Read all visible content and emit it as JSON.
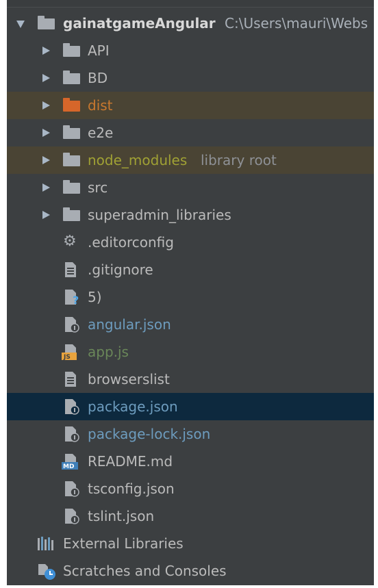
{
  "project": {
    "name": "gainatgameAngular",
    "path": "C:\\Users\\mauri\\Webs"
  },
  "folders": [
    {
      "label": "API"
    },
    {
      "label": "BD"
    },
    {
      "label": "dist"
    },
    {
      "label": "e2e"
    },
    {
      "label": "node_modules",
      "suffix": "library root"
    },
    {
      "label": "src"
    },
    {
      "label": "superadmin_libraries"
    }
  ],
  "files": [
    {
      "label": ".editorconfig",
      "icon": "gear-icon"
    },
    {
      "label": ".gitignore",
      "icon": "text-file-icon"
    },
    {
      "label": "5)",
      "icon": "unknown-file-icon"
    },
    {
      "label": "angular.json",
      "icon": "json-file-icon"
    },
    {
      "label": "app.js",
      "icon": "js-file-icon"
    },
    {
      "label": "browserslist",
      "icon": "text-file-icon"
    },
    {
      "label": "package.json",
      "icon": "json-file-icon"
    },
    {
      "label": "package-lock.json",
      "icon": "json-file-icon"
    },
    {
      "label": "README.md",
      "icon": "markdown-file-icon"
    },
    {
      "label": "tsconfig.json",
      "icon": "json-file-icon"
    },
    {
      "label": "tslint.json",
      "icon": "json-file-icon"
    }
  ],
  "bottom": [
    {
      "label": "External Libraries",
      "icon": "library-icon"
    },
    {
      "label": "Scratches and Consoles",
      "icon": "scratches-icon"
    }
  ],
  "badges": {
    "js": "JS",
    "md": "MD",
    "unknown": "?"
  },
  "colors": {
    "panel_bg": "#3c3f41",
    "selected_row": "#0d293e",
    "excluded_row": "#4a4434",
    "folder": "#a8adb3",
    "dist_folder": "#d6662a"
  }
}
